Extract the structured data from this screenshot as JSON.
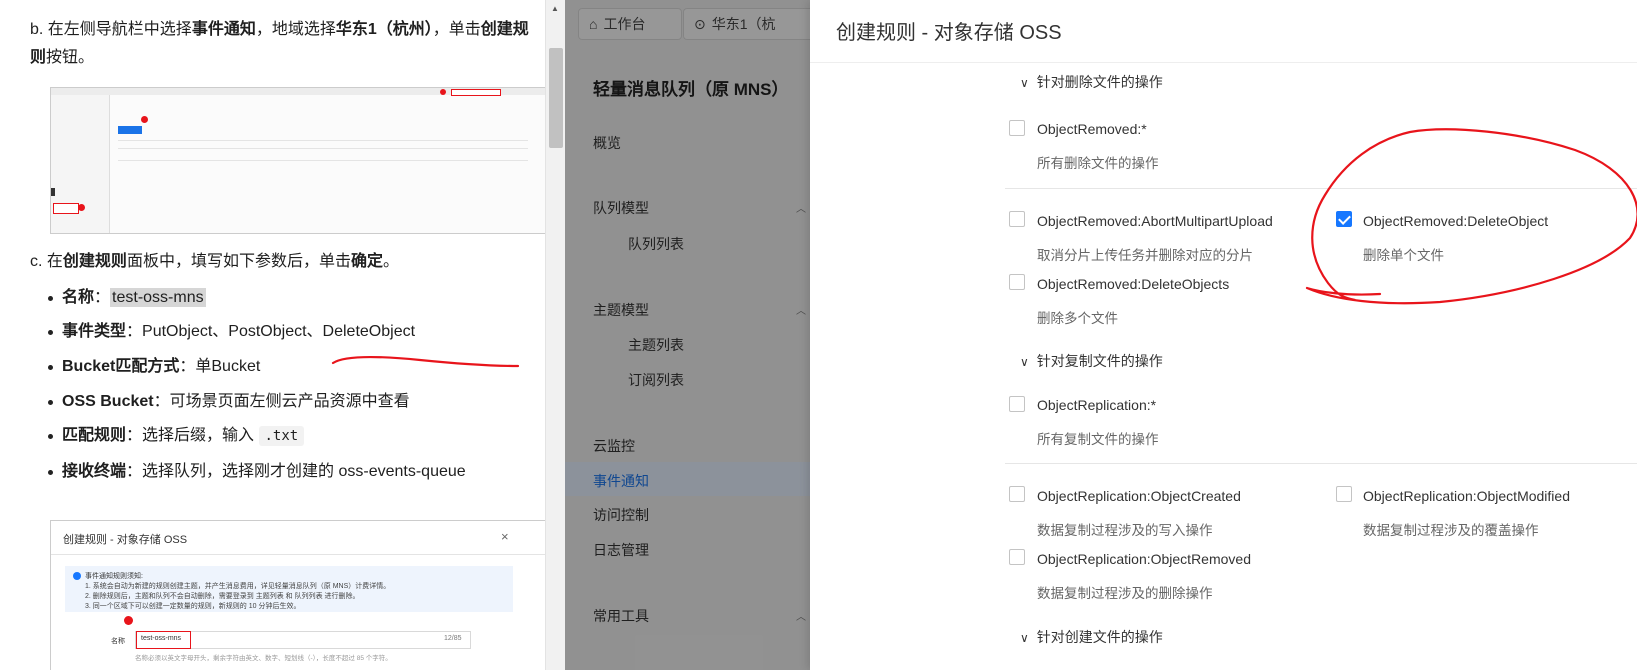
{
  "doc": {
    "step_b": {
      "prefix": "b.",
      "t1": "在左侧导航栏中选择",
      "b1": "事件通知",
      "t2": "，地域选择",
      "b2": "华东1（杭州）",
      "t3": "，单击",
      "b3": "创建规则",
      "t4": "按钮。"
    },
    "step_c": {
      "prefix": "c.",
      "t1": "在",
      "b1": "创建规则",
      "t2": "面板中，填写如下参数后，单击",
      "b2": "确定",
      "t3": "。"
    },
    "params": [
      {
        "key": "名称",
        "value": "test-oss-mns"
      },
      {
        "key": "事件类型",
        "value": "PutObject、PostObject、DeleteObject"
      },
      {
        "key": "Bucket匹配方式",
        "value": "单Bucket"
      },
      {
        "key": "OSS Bucket",
        "value": "可场景页面左侧云产品资源中查看"
      },
      {
        "key": "匹配规则",
        "value_prefix": "选择后缀，输入",
        "code": ".txt"
      },
      {
        "key": "接收终端",
        "value": "选择队列，选择刚才创建的 oss-events-queue"
      }
    ],
    "thumb2": {
      "title": "创建规则 - 对象存储 OSS",
      "close": "×",
      "notice_title": "事件通知规则须知:",
      "notice_1": "1. 系统会自动为新建的规则创建主题，并产生消息费用，详见轻量消息队列（原 MNS）计费详情。",
      "notice_2": "2. 删除规则后，主题和队列不会自动删除，需要登录到 主题列表 和 队列列表 进行删除。",
      "notice_3": "3. 同一个区域下可以创建一定数量的规则，新规则的 10 分钟后生效。",
      "name_label": "名称",
      "name_value": "test-oss-mns",
      "name_count": "12/85",
      "name_hint": "名称必须以英文字母开头，剩余字符由英文、数字、短划线（-），长度不超过 85 个字符。"
    }
  },
  "console": {
    "tab_workbench": "工作台",
    "tab_region": "华东1（杭",
    "product_title": "轻量消息队列（原 MNS）",
    "nav": {
      "overview": "概览",
      "queue_model": "队列模型",
      "queue_list": "队列列表",
      "topic_model": "主题模型",
      "topic_list": "主题列表",
      "subscription_list": "订阅列表",
      "cloud_monitor": "云监控",
      "event_notify": "事件通知",
      "access_control": "访问控制",
      "log_management": "日志管理",
      "common_tools": "常用工具"
    }
  },
  "panel": {
    "title": "创建规则 - 对象存储 OSS",
    "sections": {
      "delete": "针对删除文件的操作",
      "replicate": "针对复制文件的操作",
      "create": "针对创建文件的操作"
    },
    "options": {
      "removed_all": {
        "label": "ObjectRemoved:*",
        "desc": "所有删除文件的操作",
        "checked": false
      },
      "abort_upload": {
        "label": "ObjectRemoved:AbortMultipartUpload",
        "desc": "取消分片上传任务并删除对应的分片",
        "checked": false
      },
      "delete_object": {
        "label": "ObjectRemoved:DeleteObject",
        "desc": "删除单个文件",
        "checked": true
      },
      "delete_objects": {
        "label": "ObjectRemoved:DeleteObjects",
        "desc": "删除多个文件",
        "checked": false
      },
      "replication_all": {
        "label": "ObjectReplication:*",
        "desc": "所有复制文件的操作",
        "checked": false
      },
      "replication_created": {
        "label": "ObjectReplication:ObjectCreated",
        "desc": "数据复制过程涉及的写入操作",
        "checked": false
      },
      "replication_modified": {
        "label": "ObjectReplication:ObjectModified",
        "desc": "数据复制过程涉及的覆盖操作",
        "checked": false
      },
      "replication_removed": {
        "label": "ObjectReplication:ObjectRemoved",
        "desc": "数据复制过程涉及的删除操作",
        "checked": false
      }
    }
  },
  "colors": {
    "accent": "#1677ff",
    "annotation": "#e8141b",
    "active_nav": "#1a73e8"
  }
}
